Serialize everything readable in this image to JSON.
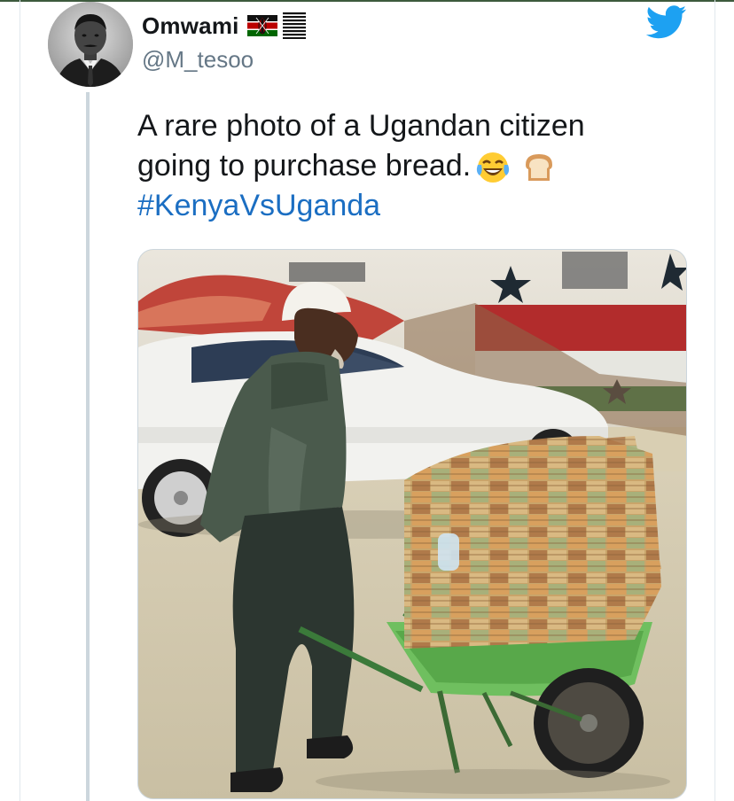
{
  "tweet": {
    "display_name": "Omwami",
    "handle": "@M_tesoo",
    "text_line1": "A rare photo of a Ugandan citizen",
    "text_line2": "going to purchase bread.",
    "hashtag": "#KenyaVsUganda"
  },
  "icons": {
    "flag": "kenya-flag-icon",
    "list": "list-lines-icon",
    "bird": "twitter-bird-icon",
    "emoji1": "face-with-tears-of-joy-icon",
    "emoji2": "bread-icon"
  },
  "colors": {
    "twitter_blue": "#1da1f2",
    "hashtag": "#1b6ec2",
    "handle_gray": "#657786",
    "thread_line": "#ccd6dd"
  }
}
